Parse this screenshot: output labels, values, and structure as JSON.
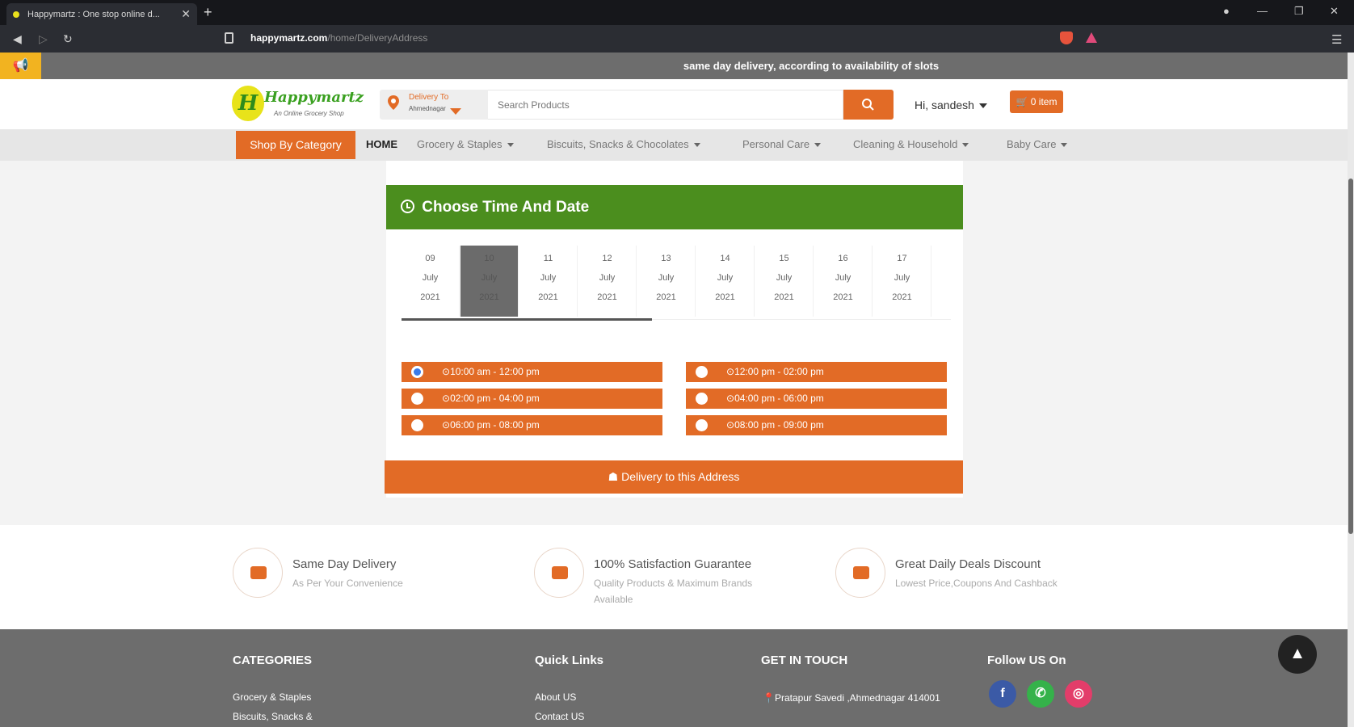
{
  "browser": {
    "tab_title": "Happymartz : One stop online d...",
    "url_host": "happymartz.com",
    "url_path": "/home/DeliveryAddress"
  },
  "announcement": "same day delivery, according to availability of slots",
  "header": {
    "logo_name": "Happymartz",
    "logo_tagline": "An Online Grocery Shop",
    "delivery_label": "Delivery To",
    "delivery_location": "Ahmednagar",
    "search_placeholder": "Search Products",
    "user_greeting": "Hi, sandesh",
    "cart_label": "0 item"
  },
  "nav": {
    "shop_by_category": "Shop By Category",
    "items": [
      {
        "label": "HOME"
      },
      {
        "label": "Grocery & Staples"
      },
      {
        "label": "Biscuits, Snacks & Chocolates"
      },
      {
        "label": "Personal Care"
      },
      {
        "label": "Cleaning & Household"
      },
      {
        "label": "Baby Care"
      }
    ]
  },
  "schedule": {
    "title": "Choose Time And Date",
    "dates": [
      {
        "day": "09",
        "month": "July",
        "year": "2021"
      },
      {
        "day": "10",
        "month": "July",
        "year": "2021"
      },
      {
        "day": "11",
        "month": "July",
        "year": "2021"
      },
      {
        "day": "12",
        "month": "July",
        "year": "2021"
      },
      {
        "day": "13",
        "month": "July",
        "year": "2021"
      },
      {
        "day": "14",
        "month": "July",
        "year": "2021"
      },
      {
        "day": "15",
        "month": "July",
        "year": "2021"
      },
      {
        "day": "16",
        "month": "July",
        "year": "2021"
      },
      {
        "day": "17",
        "month": "July",
        "year": "2021"
      }
    ],
    "selected_date_index": 1,
    "slots": [
      {
        "label": "10:00 am - 12:00 pm",
        "checked": true
      },
      {
        "label": "12:00 pm - 02:00 pm",
        "checked": false
      },
      {
        "label": "02:00 pm - 04:00 pm",
        "checked": false
      },
      {
        "label": "04:00 pm - 06:00 pm",
        "checked": false
      },
      {
        "label": "06:00 pm - 08:00 pm",
        "checked": false
      },
      {
        "label": "08:00 pm - 09:00 pm",
        "checked": false
      }
    ],
    "deliver_button": "Delivery to this Address"
  },
  "features": [
    {
      "title": "Same Day Delivery",
      "subtitle": "As Per Your Convenience"
    },
    {
      "title": "100% Satisfaction Guarantee",
      "subtitle": "Quality Products & Maximum Brands Available"
    },
    {
      "title": "Great Daily Deals Discount",
      "subtitle": "Lowest Price,Coupons And Cashback"
    }
  ],
  "footer": {
    "categories_heading": "CATEGORIES",
    "categories": [
      "Grocery & Staples",
      "Biscuits, Snacks &"
    ],
    "quicklinks_heading": "Quick Links",
    "quicklinks": [
      "About US",
      "Contact US"
    ],
    "contact_heading": "GET IN TOUCH",
    "address": "Pratapur Savedi ,Ahmednagar 414001",
    "follow_heading": "Follow US On"
  },
  "colors": {
    "accent": "#e26b26",
    "header_green": "#4b8e1e",
    "footer_gray": "#6d6d6d"
  }
}
